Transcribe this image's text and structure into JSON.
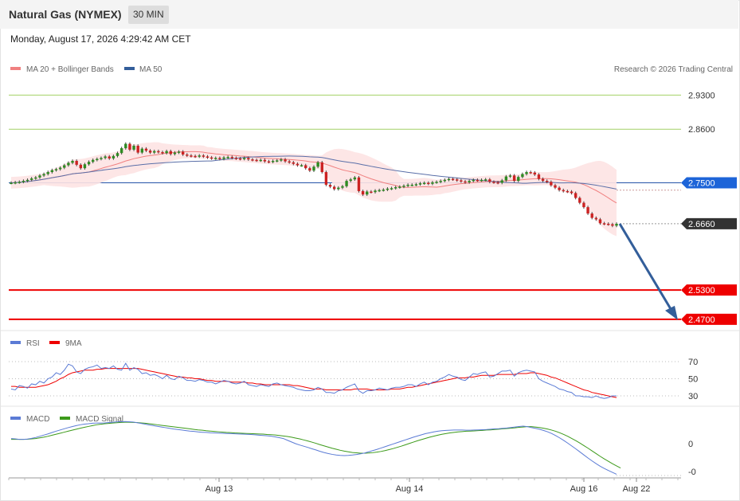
{
  "header": {
    "title": "Natural Gas (NYMEX)",
    "timeframe": "30 MIN",
    "datetime": "Monday, August 17, 2026 4:29:42 AM CET"
  },
  "credit": "Research © 2026 Trading Central",
  "colors": {
    "ma20": "#f08080",
    "ma50": "#335e9a",
    "resistance": "#8cc63f",
    "support": "#ee0000",
    "pivot": "#1d64d8",
    "rsi": "#5b7bd5",
    "macd": "#5b7bd5",
    "signal": "#3c9a1a",
    "candle_up": "#2e8b22",
    "candle_down": "#cc2222"
  },
  "chart_data": [
    {
      "type": "candlestick",
      "title": "Natural Gas (NYMEX) 30 MIN",
      "legend": [
        "MA 20 + Bollinger Bands",
        "MA 50"
      ],
      "x_labels": [
        "Aug 13",
        "Aug 14",
        "Aug 16",
        "Aug 22"
      ],
      "ylim": [
        2.46,
        2.96
      ],
      "last_price": 2.666,
      "levels": [
        {
          "kind": "resistance",
          "value": 2.93,
          "label": "2.9300"
        },
        {
          "kind": "resistance",
          "value": 2.86,
          "label": "2.8600"
        },
        {
          "kind": "pivot",
          "value": 2.75,
          "label": "2.7500"
        },
        {
          "kind": "last",
          "value": 2.666,
          "label": "2.6660"
        },
        {
          "kind": "support",
          "value": 2.53,
          "label": "2.5300"
        },
        {
          "kind": "support",
          "value": 2.47,
          "label": "2.4700"
        }
      ],
      "target_arrow": {
        "from": 2.666,
        "to": 2.47
      },
      "close": [
        2.75,
        2.751,
        2.752,
        2.754,
        2.756,
        2.759,
        2.761,
        2.765,
        2.768,
        2.772,
        2.776,
        2.778,
        2.781,
        2.786,
        2.791,
        2.795,
        2.787,
        2.78,
        2.788,
        2.793,
        2.797,
        2.799,
        2.801,
        2.804,
        2.8,
        2.805,
        2.811,
        2.821,
        2.83,
        2.818,
        2.826,
        2.812,
        2.82,
        2.816,
        2.812,
        2.815,
        2.813,
        2.811,
        2.815,
        2.809,
        2.812,
        2.814,
        2.808,
        2.806,
        2.805,
        2.804,
        2.806,
        2.804,
        2.802,
        2.8,
        2.801,
        2.799,
        2.802,
        2.803,
        2.801,
        2.8,
        2.799,
        2.801,
        2.798,
        2.797,
        2.796,
        2.797,
        2.794,
        2.793,
        2.795,
        2.796,
        2.798,
        2.794,
        2.792,
        2.789,
        2.786,
        2.786,
        2.78,
        2.775,
        2.783,
        2.792,
        2.772,
        2.746,
        2.742,
        2.737,
        2.74,
        2.743,
        2.754,
        2.757,
        2.761,
        2.733,
        2.726,
        2.732,
        2.731,
        2.734,
        2.735,
        2.736,
        2.738,
        2.739,
        2.741,
        2.742,
        2.744,
        2.746,
        2.746,
        2.747,
        2.749,
        2.75,
        2.748,
        2.751,
        2.752,
        2.754,
        2.756,
        2.758,
        2.757,
        2.755,
        2.753,
        2.751,
        2.754,
        2.756,
        2.755,
        2.756,
        2.757,
        2.752,
        2.751,
        2.75,
        2.755,
        2.763,
        2.765,
        2.754,
        2.762,
        2.768,
        2.772,
        2.771,
        2.767,
        2.758,
        2.754,
        2.752,
        2.745,
        2.74,
        2.735,
        2.733,
        2.732,
        2.729,
        2.719,
        2.709,
        2.7,
        2.687,
        2.678,
        2.675,
        2.667,
        2.666,
        2.665,
        2.662,
        2.666
      ]
    },
    {
      "type": "line",
      "title": "RSI",
      "legend": [
        "RSI",
        "9MA"
      ],
      "y_ticks": [
        70,
        50,
        30
      ],
      "ylim": [
        20,
        80
      ],
      "series": [
        {
          "name": "RSI",
          "values": [
            38,
            37,
            42,
            41,
            39,
            44,
            43,
            47,
            45,
            50,
            52,
            57,
            55,
            60,
            67,
            65,
            58,
            56,
            61,
            63,
            64,
            66,
            62,
            63,
            62,
            65,
            61,
            60,
            68,
            60,
            63,
            61,
            56,
            57,
            54,
            55,
            53,
            50,
            54,
            50,
            49,
            53,
            51,
            48,
            48,
            47,
            49,
            48,
            46,
            46,
            44,
            46,
            48,
            47,
            45,
            44,
            45,
            47,
            43,
            42,
            41,
            43,
            42,
            41,
            44,
            45,
            43,
            42,
            41,
            40,
            38,
            37,
            36,
            36,
            37,
            40,
            38,
            34,
            34,
            33,
            36,
            37,
            40,
            42,
            44,
            36,
            33,
            36,
            36,
            37,
            39,
            38,
            37,
            39,
            40,
            40,
            41,
            43,
            43,
            41,
            44,
            46,
            43,
            46,
            47,
            50,
            52,
            55,
            53,
            52,
            49,
            48,
            52,
            56,
            55,
            57,
            58,
            52,
            53,
            56,
            59,
            59,
            60,
            53,
            57,
            59,
            60,
            59,
            58,
            50,
            47,
            45,
            43,
            41,
            38,
            37,
            35,
            34,
            30,
            30,
            29,
            29,
            28,
            30,
            28,
            27,
            28,
            30,
            30
          ]
        },
        {
          "name": "9MA",
          "values": [
            41,
            41,
            40,
            40,
            40,
            40,
            40,
            41,
            42,
            43,
            45,
            47,
            50,
            52,
            55,
            57,
            58,
            59,
            60,
            60,
            60,
            61,
            61,
            62,
            62,
            62,
            62,
            62,
            62,
            62,
            62,
            62,
            61,
            60,
            59,
            58,
            57,
            56,
            55,
            54,
            53,
            52,
            52,
            51,
            51,
            50,
            50,
            49,
            48,
            48,
            47,
            47,
            47,
            47,
            46,
            46,
            46,
            46,
            45,
            45,
            44,
            44,
            43,
            43,
            43,
            43,
            43,
            43,
            43,
            42,
            42,
            41,
            40,
            39,
            38,
            38,
            38,
            37,
            37,
            37,
            37,
            37,
            37,
            37,
            38,
            38,
            38,
            38,
            37,
            37,
            37,
            37,
            37,
            38,
            38,
            38,
            39,
            40,
            40,
            41,
            42,
            43,
            44,
            45,
            46,
            47,
            48,
            49,
            50,
            51,
            51,
            51,
            52,
            52,
            53,
            54,
            54,
            54,
            54,
            55,
            55,
            55,
            55,
            55,
            56,
            56,
            56,
            57,
            57,
            56,
            55,
            54,
            52,
            51,
            49,
            47,
            45,
            43,
            41,
            39,
            37,
            36,
            34,
            33,
            32,
            31,
            30,
            29,
            28
          ]
        }
      ]
    },
    {
      "type": "line",
      "title": "MACD",
      "legend": [
        "MACD",
        "MACD Signal"
      ],
      "y_ticks": [
        "0",
        "-0"
      ],
      "ylim": [
        -0.03,
        0.018
      ],
      "series": [
        {
          "name": "MACD",
          "values": [
            0.003,
            0.0028,
            0.0025,
            0.0025,
            0.0027,
            0.0031,
            0.0036,
            0.0043,
            0.005,
            0.0057,
            0.0065,
            0.0073,
            0.008,
            0.0087,
            0.0094,
            0.01,
            0.0106,
            0.0111,
            0.0115,
            0.0117,
            0.012,
            0.0121,
            0.0121,
            0.0122,
            0.0124,
            0.0126,
            0.0128,
            0.0129,
            0.013,
            0.0129,
            0.0127,
            0.0123,
            0.0119,
            0.0115,
            0.011,
            0.0106,
            0.0102,
            0.0098,
            0.0094,
            0.009,
            0.0086,
            0.0083,
            0.008,
            0.0077,
            0.0074,
            0.0072,
            0.0069,
            0.0067,
            0.0066,
            0.0064,
            0.0063,
            0.0062,
            0.0061,
            0.006,
            0.0059,
            0.0058,
            0.0057,
            0.0056,
            0.0055,
            0.0054,
            0.0052,
            0.005,
            0.0048,
            0.0046,
            0.0044,
            0.004,
            0.0035,
            0.003,
            0.002,
            0.001,
            0.0,
            -0.0008,
            -0.0015,
            -0.0022,
            -0.003,
            -0.0037,
            -0.0045,
            -0.0052,
            -0.0058,
            -0.0063,
            -0.0067,
            -0.0069,
            -0.007,
            -0.0069,
            -0.0067,
            -0.0064,
            -0.006,
            -0.0055,
            -0.0048,
            -0.0041,
            -0.0034,
            -0.0026,
            -0.0018,
            -0.001,
            -0.0002,
            0.0006,
            0.0014,
            0.0022,
            0.003,
            0.0038,
            0.0045,
            0.0052,
            0.0059,
            0.0064,
            0.0069,
            0.0073,
            0.0076,
            0.0078,
            0.0079,
            0.008,
            0.008,
            0.008,
            0.0079,
            0.0079,
            0.008,
            0.0081,
            0.0082,
            0.0083,
            0.0085,
            0.0087,
            0.0088,
            0.009,
            0.0092,
            0.0095,
            0.0098,
            0.0101,
            0.0103,
            0.01,
            0.0095,
            0.009,
            0.0085,
            0.0078,
            0.007,
            0.006,
            0.0048,
            0.0034,
            0.0019,
            0.0003,
            -0.0014,
            -0.0031,
            -0.0049,
            -0.0067,
            -0.0085,
            -0.0102,
            -0.0118,
            -0.0133,
            -0.0146,
            -0.0158,
            -0.0169,
            -0.018
          ]
        },
        {
          "name": "MACD Signal",
          "values": [
            0.0025,
            0.0026,
            0.0025,
            0.0025,
            0.0026,
            0.0028,
            0.003,
            0.0034,
            0.0038,
            0.0043,
            0.0049,
            0.0055,
            0.0061,
            0.0067,
            0.0073,
            0.0079,
            0.0085,
            0.0091,
            0.0096,
            0.0101,
            0.0106,
            0.0111,
            0.0114,
            0.0117,
            0.0119,
            0.0121,
            0.0123,
            0.0125,
            0.0126,
            0.0126,
            0.0125,
            0.0124,
            0.0122,
            0.012,
            0.0117,
            0.0114,
            0.0111,
            0.0108,
            0.0105,
            0.0102,
            0.0099,
            0.0096,
            0.0093,
            0.009,
            0.0087,
            0.0084,
            0.0081,
            0.0079,
            0.0076,
            0.0074,
            0.0072,
            0.007,
            0.0068,
            0.0066,
            0.0065,
            0.0063,
            0.0062,
            0.0061,
            0.006,
            0.0059,
            0.0058,
            0.0057,
            0.0056,
            0.0054,
            0.0053,
            0.0051,
            0.0048,
            0.0045,
            0.0042,
            0.0038,
            0.0033,
            0.0028,
            0.0022,
            0.0016,
            0.0009,
            0.0002,
            -0.0006,
            -0.0013,
            -0.002,
            -0.0027,
            -0.0033,
            -0.0039,
            -0.0044,
            -0.0048,
            -0.0052,
            -0.0054,
            -0.0056,
            -0.0056,
            -0.0055,
            -0.0053,
            -0.005,
            -0.0046,
            -0.0041,
            -0.0035,
            -0.0029,
            -0.0022,
            -0.0015,
            -0.0007,
            0.0001,
            0.0009,
            0.0017,
            0.0024,
            0.0031,
            0.0038,
            0.0044,
            0.005,
            0.0055,
            0.0059,
            0.0063,
            0.0066,
            0.0069,
            0.0071,
            0.0073,
            0.0074,
            0.0075,
            0.0077,
            0.0078,
            0.008,
            0.0081,
            0.0083,
            0.0085,
            0.0087,
            0.0089,
            0.0091,
            0.0093,
            0.0096,
            0.0098,
            0.01,
            0.01,
            0.0098,
            0.0095,
            0.0091,
            0.0086,
            0.008,
            0.0073,
            0.0064,
            0.0054,
            0.0043,
            0.003,
            0.0017,
            0.0003,
            -0.0012,
            -0.0027,
            -0.0043,
            -0.0059,
            -0.0075,
            -0.009,
            -0.0104,
            -0.0118,
            -0.0131,
            -0.0143
          ]
        }
      ]
    }
  ]
}
